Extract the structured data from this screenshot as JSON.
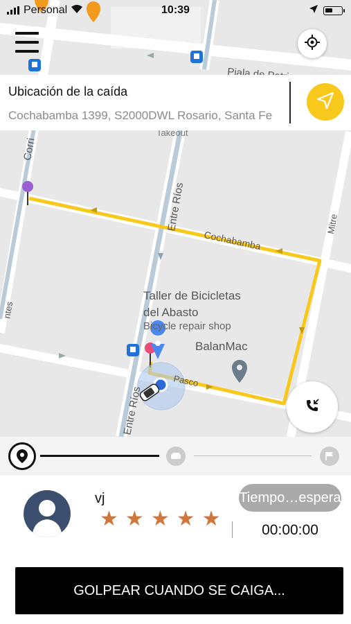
{
  "status_bar": {
    "carrier": "Personal",
    "time": "10:39"
  },
  "map": {
    "labels": {
      "street_piala": "Piala de Patria",
      "street_corrientes": "Corri",
      "street_entre_rios_upper": "Entre Ríos",
      "street_entre_rios_lower": "Entre Ríos",
      "street_cochabamba": "Cochabamba",
      "street_mitre": "Mitre",
      "street_pasco": "Pasco",
      "street_left_edge": "ntes",
      "takeout": "Takeout",
      "poi_bike_name_line1": "Taller de Bicicletas",
      "poi_bike_name_line2": "del Abasto",
      "poi_bike_category": "Bicycle repair shop",
      "poi_balanmac": "BalanMac"
    },
    "colors": {
      "route": "#f8c81c",
      "map_bg": "#e8e8e8",
      "road": "#ffffff",
      "avenue": "#b9cbd8"
    }
  },
  "address": {
    "title": "Ubicación de la caída",
    "value": "Cochabamba 1399, S2000DWL Rosario, Santa Fe"
  },
  "driver": {
    "name": "vj",
    "stars": [
      "★",
      "★",
      "★",
      "★",
      "★"
    ],
    "rating": 5
  },
  "wait": {
    "button_label": "Tiempo…espera",
    "timer": "00:00:00"
  },
  "action": {
    "main_button": "GOLPEAR CUANDO SE CAIGA..."
  },
  "icons": {
    "menu": "hamburger-menu-icon",
    "locate": "crosshair-icon",
    "navigate": "paper-plane-icon",
    "call": "phone-icon"
  }
}
